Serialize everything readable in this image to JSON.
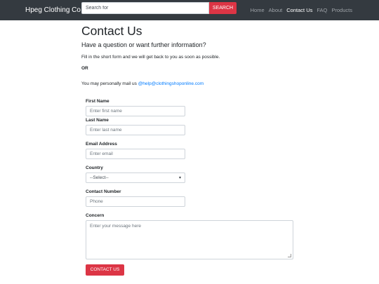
{
  "navbar": {
    "brand": "Hpeg Clothing Co",
    "search": {
      "placeholder": "Search for",
      "button_label": "SEARCH"
    },
    "links": [
      {
        "label": "Home",
        "active": false
      },
      {
        "label": "About",
        "active": false
      },
      {
        "label": "Contact Us",
        "active": true
      },
      {
        "label": "FAQ",
        "active": false
      },
      {
        "label": "Products",
        "active": false
      }
    ]
  },
  "main": {
    "title": "Contact Us",
    "subtitle": "Have a question or want further information?",
    "intro": "Fill in the short form and we will get back to you as soon as possible.",
    "or_text": "OR",
    "mail_prefix": "You may personally mail us ",
    "mail_link": "@help@clothingshoponline.com"
  },
  "form": {
    "first_name": {
      "label": "First Name",
      "placeholder": "Enter first name"
    },
    "last_name": {
      "label": "Last Name",
      "placeholder": "Enter last name"
    },
    "email": {
      "label": "Email Address",
      "placeholder": "Enter email"
    },
    "country": {
      "label": "Country",
      "selected": "--Select--"
    },
    "phone": {
      "label": "Contact Number",
      "placeholder": "Phone"
    },
    "concern": {
      "label": "Concern",
      "placeholder": "Enter your message here"
    },
    "submit_label": "CONTACT US"
  },
  "colors": {
    "navbar_bg": "#343a40",
    "accent": "#dc3545",
    "link": "#007bff"
  }
}
